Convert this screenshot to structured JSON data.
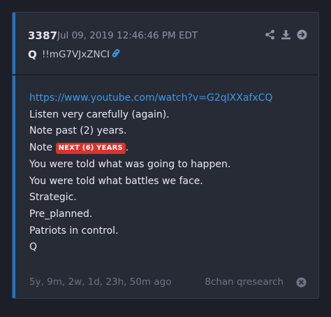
{
  "post": {
    "number": "3387",
    "date": "Jul 09, 2019 12:46:46 PM EDT",
    "author": "Q",
    "tripcode": "!!mG7VJxZNCI"
  },
  "body": {
    "url": "https://www.youtube.com/watch?v=G2qIXXafxCQ",
    "line1": "Listen very carefully (again).",
    "line2": "Note past (2) years.",
    "line3_prefix": "Note",
    "line3_badge": "NEXT (6) YEARS",
    "line3_suffix": ".",
    "line4": "You were told what was going to happen.",
    "line5": "You were told what battles we face.",
    "line6": "Strategic.",
    "line7": "Pre_planned.",
    "line8": "Patriots in control.",
    "line9": "Q"
  },
  "footer": {
    "age": "5y, 9m, 2w, 1d, 23h, 50m ago",
    "board": "8chan qresearch"
  },
  "icons": {
    "share": "share-icon",
    "download": "download-icon",
    "forward": "arrow-right-circle-icon",
    "link": "link-icon",
    "close": "close-circle-icon"
  },
  "colors": {
    "accent": "#1f75c4",
    "link": "#3c9ae6",
    "badge": "#d9342b",
    "background": "#1c1f28",
    "card": "#272b36"
  }
}
